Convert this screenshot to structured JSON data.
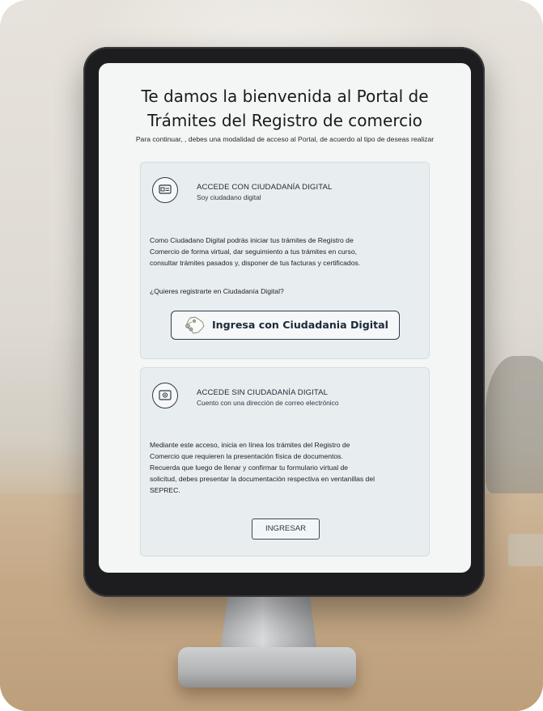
{
  "portal": {
    "title_line1": "Te damos la bienvenida al Portal de",
    "title_line2": "Trámites del Registro de comercio",
    "subtitle": "Para continuar, , debes una modalidad de acceso al Portal, de acuerdo al tipo de deseas realizar"
  },
  "card_digital": {
    "icon": "id-card-icon",
    "title": "ACCEDE CON CIUDADANÍA DIGITAL",
    "subtitle": "Soy ciudadano digital",
    "body_line1": "Como Ciudadano Digital podrás iniciar tus trámites de Registro de",
    "body_line2": "Comercio de forma virtual, dar seguimiento a tus trámites en curso,",
    "body_line3": "consultar trámites pasados y, disponer de tus facturas y certificados.",
    "question": "¿Quieres registrarte en Ciudadanía Digital?",
    "button_label": "Ingresa con Ciudadania Digital",
    "button_icon": "bolivia-map-icon"
  },
  "card_no_digital": {
    "icon": "email-card-icon",
    "title": "ACCEDE SIN CIUDADANÍA DIGITAL",
    "subtitle": "Cuento con una dirección de correo electrónico",
    "body_line1": "Mediante este acceso, inicia en línea los trámites del Registro de",
    "body_line2": "Comercio que requieren la presentación física de documentos.",
    "body_line3": "Recuerda que luego de llenar y confirmar tu formulario virtual de",
    "body_line4": "solicitud, debes presentar la documentación respectiva en ventanillas del",
    "body_line5": "SEPREC.",
    "button_label": "INGRESAR"
  },
  "colors": {
    "card_bg": "#e8eef0",
    "accent": "#2f3d4a",
    "screen_bg": "#f4f5f5"
  }
}
